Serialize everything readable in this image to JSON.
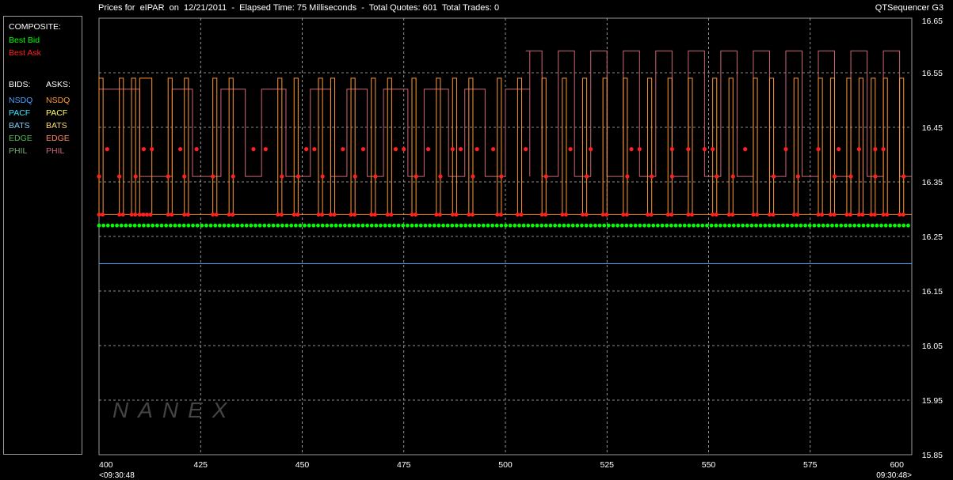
{
  "header": {
    "title": "Prices for  eIPAR  on  12/21/2011  -  Elapsed Time: 75 Milliseconds  -  Total Quotes: 601  Total Trades: 0",
    "app": "QTSequencer G3"
  },
  "legend": {
    "composite_label": "COMPOSITE:",
    "best_bid": "Best Bid",
    "best_ask": "Best Ask",
    "bids_label": "BIDS:",
    "asks_label": "ASKS:",
    "bids": [
      "NSDQ",
      "PACF",
      "BATS",
      "EDGE",
      "PHIL"
    ],
    "asks": [
      "NSDQ",
      "PACF",
      "BATS",
      "EDGE",
      "PHIL"
    ],
    "colors": {
      "best_bid": "#00ff00",
      "best_ask": "#ff2020",
      "bid_nsdq": "#4aa3ff",
      "bid_pacf": "#34e8ff",
      "bid_bats": "#88ccff",
      "bid_edge": "#55bb55",
      "bid_phil": "#77aa77",
      "ask_nsdq": "#ff9933",
      "ask_pacf": "#ffff66",
      "ask_bats": "#ffdd77",
      "ask_edge": "#ff8866",
      "ask_phil": "#cc6677"
    }
  },
  "watermark": "NANEX",
  "chart_data": {
    "type": "line",
    "x_ticks": [
      "400",
      "425",
      "450",
      "475",
      "500",
      "525",
      "550",
      "575",
      "600"
    ],
    "x_start_time": "<09:30:48",
    "x_end_time": "09:30:48>",
    "xlim": [
      400,
      600
    ],
    "ylim": [
      15.85,
      16.65
    ],
    "y_ticks": [
      "16.65",
      "16.55",
      "16.45",
      "16.35",
      "16.25",
      "16.15",
      "16.05",
      "15.95",
      "15.85"
    ],
    "grid": true,
    "series": [
      {
        "name": "Best Bid",
        "values": [
          16.27
        ]
      },
      {
        "name": "Best Ask",
        "low": 16.29,
        "mid": 16.36,
        "high": 16.41
      },
      {
        "name": "NSDQ",
        "side": "bid",
        "values": [
          16.2
        ]
      },
      {
        "name": "NSDQ",
        "side": "ask",
        "low": 16.29,
        "high": 16.54,
        "x_switch": [
          400,
          401,
          405,
          406,
          408,
          409,
          410,
          413,
          417,
          418,
          421,
          422,
          428,
          429,
          432,
          433,
          444,
          445,
          448,
          449,
          454,
          455,
          457,
          458,
          462,
          463,
          467,
          468,
          471,
          472,
          477,
          478,
          483,
          484,
          487,
          488,
          491,
          492,
          498,
          499,
          503,
          504,
          509,
          510,
          514,
          515,
          519,
          520,
          524,
          525,
          529,
          530,
          535,
          536,
          540,
          541,
          545,
          546,
          551,
          552,
          555,
          556,
          561,
          562,
          565,
          566,
          571,
          572,
          577,
          578,
          580,
          581,
          584,
          585,
          587,
          588,
          590,
          591,
          593,
          594,
          597,
          598
        ]
      },
      {
        "name": "PHIL",
        "side": "ask",
        "low": 16.36,
        "mid": 16.52,
        "high": 16.59
      }
    ]
  }
}
